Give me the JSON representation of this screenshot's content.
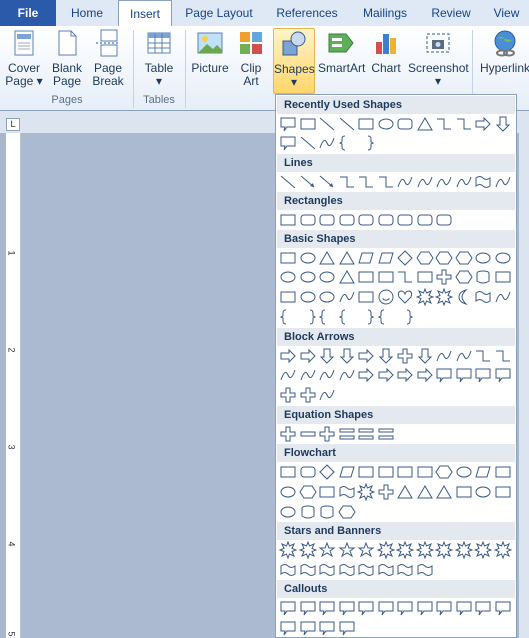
{
  "tabs": [
    {
      "label": "File"
    },
    {
      "label": "Home"
    },
    {
      "label": "Insert"
    },
    {
      "label": "Page Layout"
    },
    {
      "label": "References"
    },
    {
      "label": "Mailings"
    },
    {
      "label": "Review"
    },
    {
      "label": "View"
    }
  ],
  "ribbon": {
    "cover_page": {
      "line1": "Cover",
      "line2": "Page"
    },
    "blank_page": {
      "line1": "Blank",
      "line2": "Page"
    },
    "page_break": {
      "line1": "Page",
      "line2": "Break"
    },
    "table": "Table",
    "picture": "Picture",
    "clip_art": {
      "line1": "Clip",
      "line2": "Art"
    },
    "shapes": "Shapes",
    "smartart": "SmartArt",
    "chart": "Chart",
    "screenshot": "Screenshot",
    "hyperlink": "Hyperlink",
    "groups": {
      "pages": "Pages",
      "tables": "Tables"
    }
  },
  "ruler": {
    "corner": "L",
    "numbers": [
      "1",
      "2",
      "3",
      "4",
      "5"
    ]
  },
  "shapes_gallery": {
    "sections": [
      "Recently Used Shapes",
      "Lines",
      "Rectangles",
      "Basic Shapes",
      "Block Arrows",
      "Equation Shapes",
      "Flowchart",
      "Stars and Banners",
      "Callouts"
    ]
  },
  "colors": {
    "accent": "#2a5aa9",
    "stroke": "#3b5a85",
    "highlight": "#ffd66b"
  }
}
